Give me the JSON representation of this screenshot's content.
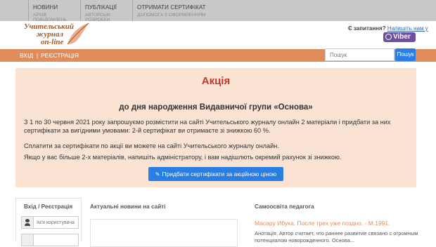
{
  "top_menu": [
    {
      "label": "Новини",
      "sub": "Архів повідомлень"
    },
    {
      "label": "Публікації",
      "sub": "Авторські розробки"
    },
    {
      "label": "Отримати сертифікат",
      "sub": "Допомога з оформленням"
    }
  ],
  "logo": {
    "line1": "Учительський",
    "line2": "журнал",
    "line3": "on-line"
  },
  "contact": {
    "question": "Є запитання?",
    "link": "Напишіть нам у",
    "viber_label": "Viber"
  },
  "nav": {
    "login": "Вхід",
    "register": "Реєстрація"
  },
  "search": {
    "placeholder": "Пошук",
    "button": "Пошук"
  },
  "promo": {
    "title": "Акція",
    "subtitle": "до дня народження Видавничої групи «Основа»",
    "p1": "З 1 по 30 червня 2021 року запрошуємо розмістити на сайті Учительського журналу онлайн 2 матеріали і придбати за них сертифікати за вигідними умовами: 2-й сертифікат ви отримаєте зі знижкою 60 %.",
    "p2": "Сплатити за сертифікати по акції ви можете на сайті Учительського журналу онлайн.",
    "p3": "Якщо у вас більше 2-х матеріалів, напишіть адміністратору, і вам надішлють окремий рахунок зі знижкою.",
    "button": "Придбати сертифікати за акційною ціною"
  },
  "columns": {
    "login_title": "Вхід / Реєстрація",
    "news_title": "Актуальні новини на сайті",
    "self_title": "Самоосвіта педагога"
  },
  "login": {
    "username_placeholder": "Ім'я користувача"
  },
  "self_education": {
    "link": "Масару Ибука. После трех уже поздно. - М.1991.",
    "annotation": "Анотація: Автор считает, что раннее развитие связано с огромным потенциалом новорожденного. Основа..."
  },
  "colors": {
    "accent": "#e08c5a",
    "promo_bg": "#fae3d2",
    "button": "#2a7de1",
    "title_red": "#c0392b",
    "viber": "#6e4fa0"
  }
}
